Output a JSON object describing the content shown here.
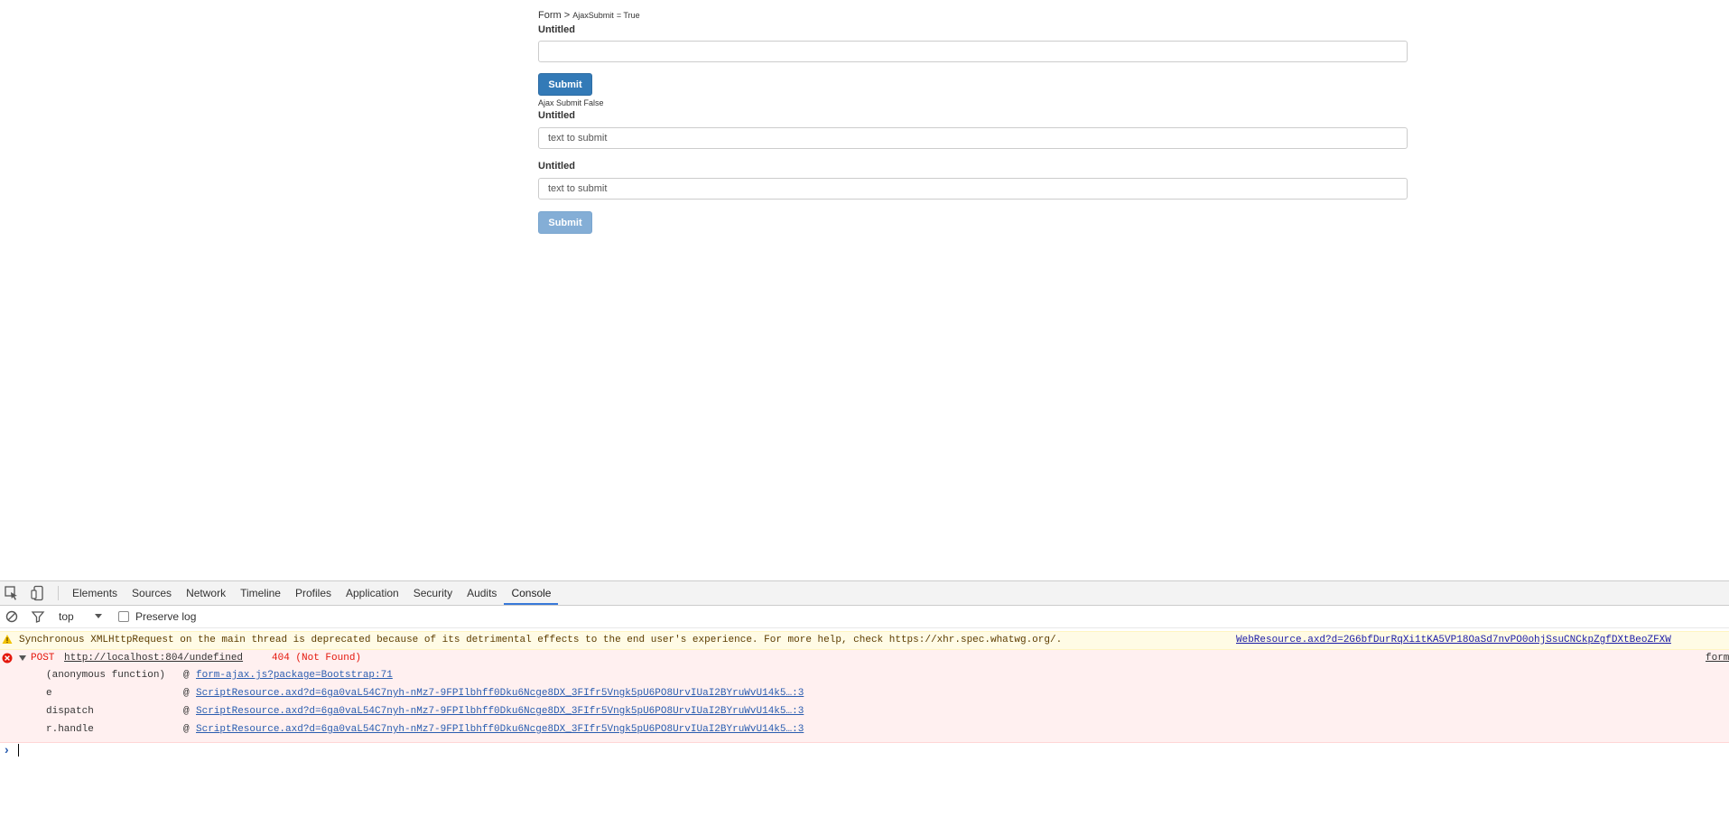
{
  "page": {
    "breadcrumb": {
      "root": "Form",
      "sep": ">",
      "item": "AjaxSubmit",
      "value": "= True"
    },
    "form1": {
      "label": "Untitled",
      "input_value": "",
      "submit_label": "Submit"
    },
    "ajax_line": {
      "label": "Ajax Submit",
      "value": "False"
    },
    "form2": {
      "label1": "Untitled",
      "input1_value": "text to submit",
      "label2": "Untitled",
      "input2_value": "text to submit",
      "submit_label": "Submit"
    }
  },
  "devtools": {
    "tabs": [
      "Elements",
      "Sources",
      "Network",
      "Timeline",
      "Profiles",
      "Application",
      "Security",
      "Audits",
      "Console"
    ],
    "active_tab": "Console",
    "filter": {
      "context": "top",
      "preserve_log_label": "Preserve log",
      "preserve_log_checked": false
    },
    "warning": {
      "text": "Synchronous XMLHttpRequest on the main thread is deprecated because of its detrimental effects to the end user's experience. For more help, check https://xhr.spec.whatwg.org/.",
      "source": "WebResource.axd?d=2G6bfDurRqXi1tKA5VP18OaSd7nvPO0ohjSsuCNCkpZgfDXtBeoZFXW"
    },
    "error": {
      "method": "POST",
      "url": "http://localhost:804/undefined",
      "status": "404 (Not Found)",
      "source": "form",
      "stack": [
        {
          "fn": "(anonymous function)",
          "at": "@",
          "loc": "form-ajax.js?package=Bootstrap:71"
        },
        {
          "fn": "e",
          "at": "@",
          "loc": "ScriptResource.axd?d=6ga0vaL54C7nyh-nMz7-9FPIlbhff0Dku6Ncge8DX_3FIfr5Vngk5pU6PO8UrvIUaI2BYruWvU14k5…:3"
        },
        {
          "fn": "dispatch",
          "at": "@",
          "loc": "ScriptResource.axd?d=6ga0vaL54C7nyh-nMz7-9FPIlbhff0Dku6Ncge8DX_3FIfr5Vngk5pU6PO8UrvIUaI2BYruWvU14k5…:3"
        },
        {
          "fn": "r.handle",
          "at": "@",
          "loc": "ScriptResource.axd?d=6ga0vaL54C7nyh-nMz7-9FPIlbhff0Dku6Ncge8DX_3FIfr5Vngk5pU6PO8UrvIUaI2BYruWvU14k5…:3"
        }
      ]
    },
    "prompt_symbol": "›"
  },
  "colors": {
    "primary": "#337ab7",
    "primary_disabled": "#84aed6",
    "active_tab": "#3879d9",
    "error_bg": "#fff0f0",
    "warning_bg": "#fffbe5",
    "error_text": "#e4170c"
  }
}
